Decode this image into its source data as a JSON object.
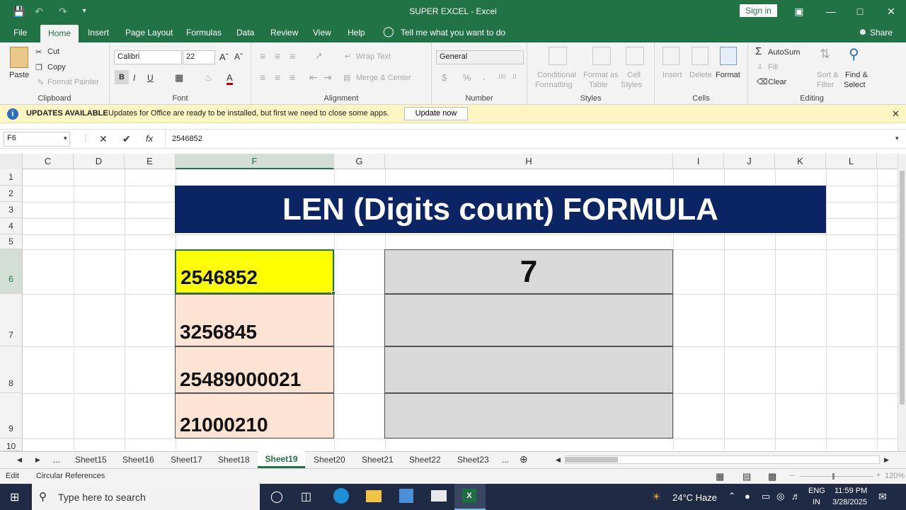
{
  "window": {
    "title": "SUPER EXCEL  -  Excel",
    "sign_in": "Sign in"
  },
  "ribbon_tabs": [
    "File",
    "Home",
    "Insert",
    "Page Layout",
    "Formulas",
    "Data",
    "Review",
    "View",
    "Help"
  ],
  "tell_me": "Tell me what you want to do",
  "share": "Share",
  "clipboard": {
    "paste": "Paste",
    "cut": "Cut",
    "copy": "Copy",
    "format_painter": "Format Painter",
    "label": "Clipboard"
  },
  "font": {
    "name": "Calibri",
    "size": "22",
    "label": "Font",
    "bold": "B",
    "italic": "I",
    "underline": "U"
  },
  "alignment": {
    "wrap": "Wrap Text",
    "merge": "Merge & Center",
    "label": "Alignment"
  },
  "number": {
    "format": "General",
    "label": "Number",
    "currency": "$",
    "percent": "%",
    "comma": ","
  },
  "styles": {
    "conditional": "Conditional",
    "formatting": "Formatting",
    "format_as": "Format as",
    "table": "Table",
    "cell": "Cell",
    "styles_word": "Styles",
    "label": "Styles"
  },
  "cells": {
    "insert": "Insert",
    "delete": "Delete",
    "format": "Format",
    "label": "Cells"
  },
  "editing": {
    "autosum": "AutoSum",
    "fill": "Fill",
    "clear": "Clear",
    "sort": "Sort &",
    "filter": "Filter",
    "find": "Find &",
    "select": "Select",
    "label": "Editing"
  },
  "update_bar": {
    "title": "UPDATES AVAILABLE",
    "message": "Updates for Office are ready to be installed, but first we need to close some apps.",
    "button": "Update now"
  },
  "formula_bar": {
    "name_box": "F6",
    "value": "2546852"
  },
  "columns": [
    "C",
    "D",
    "E",
    "F",
    "G",
    "H",
    "I",
    "J",
    "K",
    "L"
  ],
  "rows": [
    "1",
    "2",
    "3",
    "4",
    "5",
    "6",
    "7",
    "8",
    "9",
    "10"
  ],
  "banner": "LEN (Digits count) FORMULA",
  "f_values": [
    "2546852",
    "3256845",
    "25489000021",
    "21000210"
  ],
  "h_values": [
    "7",
    "",
    "",
    ""
  ],
  "sheets": [
    "...",
    "Sheet15",
    "Sheet16",
    "Sheet17",
    "Sheet18",
    "Sheet19",
    "Sheet20",
    "Sheet21",
    "Sheet22",
    "Sheet23",
    "..."
  ],
  "active_sheet": "Sheet19",
  "status": {
    "mode": "Edit",
    "circular": "Circular References",
    "zoom": "120%"
  },
  "taskbar": {
    "search": "Type here to search",
    "weather": "24°C  Haze",
    "lang1": "ENG",
    "lang2": "IN",
    "time": "11:59 PM",
    "date": "3/28/2025"
  }
}
